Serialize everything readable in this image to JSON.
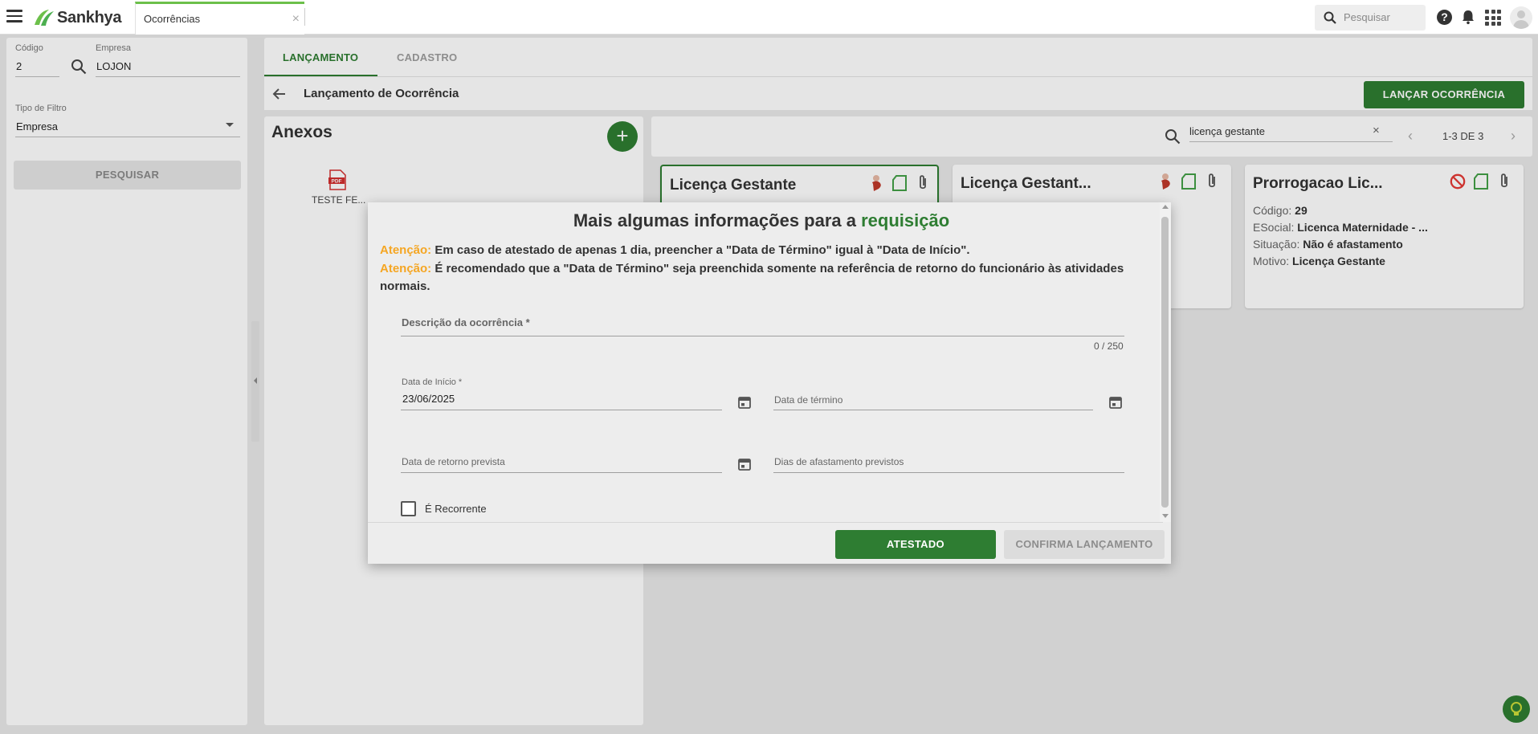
{
  "topbar": {
    "brand": "Sankhya",
    "tab_label": "Ocorrências",
    "tab_close": "×",
    "search_placeholder": "Pesquisar",
    "help": "?"
  },
  "filters": {
    "codigo_label": "Código",
    "codigo_value": "2",
    "empresa_label": "Empresa",
    "empresa_value": "LOJON",
    "tipo_filtro_label": "Tipo de Filtro",
    "tipo_filtro_value": "Empresa",
    "search_button": "PESQUISAR"
  },
  "main": {
    "tabs": [
      {
        "label": "LANÇAMENTO",
        "active": true
      },
      {
        "label": "CADASTRO",
        "active": false
      }
    ],
    "title": "Lançamento de Ocorrência",
    "primary_button": "LANÇAR OCORRÊNCIA"
  },
  "anexos": {
    "title": "Anexos",
    "add": "+",
    "files": [
      {
        "name": "TESTE FE...",
        "type": "PDF"
      }
    ]
  },
  "results": {
    "search_value": "licença gestante",
    "clear": "×",
    "pagination": "1-3 DE 3",
    "prev": "‹",
    "next": "›",
    "cards": [
      {
        "title": "Licença Gestante",
        "selected": true
      },
      {
        "title": "Licença Gestant...",
        "selected": false
      },
      {
        "title": "Prorrogacao Lic...",
        "selected": false,
        "rows": [
          {
            "label": "Código:",
            "value": "29"
          },
          {
            "label": "ESocial:",
            "value": "Licenca Maternidade - ..."
          },
          {
            "label": "Situação:",
            "value": "Não é afastamento"
          },
          {
            "label": "Motivo:",
            "value": "Licença Gestante"
          }
        ]
      }
    ]
  },
  "modal": {
    "heading_prefix": "Mais algumas informações para a ",
    "heading_accent": "requisição",
    "warning_label": "Atenção:",
    "warning_1": "Em caso de atestado de apenas 1 dia, preencher a \"Data de Término\" igual à \"Data de Início\".",
    "warning_2": "É recomendado que a \"Data de Término\" seja preenchida somente na referência de retorno do funcionário às atividades normais.",
    "descricao_label": "Descrição da ocorrência *",
    "descricao_counter": "0 / 250",
    "data_inicio_label": "Data de Início *",
    "data_inicio_value": "23/06/2025",
    "data_termino_placeholder": "Data de término",
    "data_retorno_placeholder": "Data de retorno prevista",
    "dias_afastamento_placeholder": "Dias de afastamento previstos",
    "recorrente_label": "É Recorrente",
    "recorrente_checked": false,
    "btn_atestado": "ATESTADO",
    "btn_confirma": "CONFIRMA LANÇAMENTO"
  },
  "colors": {
    "primary": "#2e7d32",
    "warning": "#f5a623",
    "brand_green": "#6cc04a"
  }
}
